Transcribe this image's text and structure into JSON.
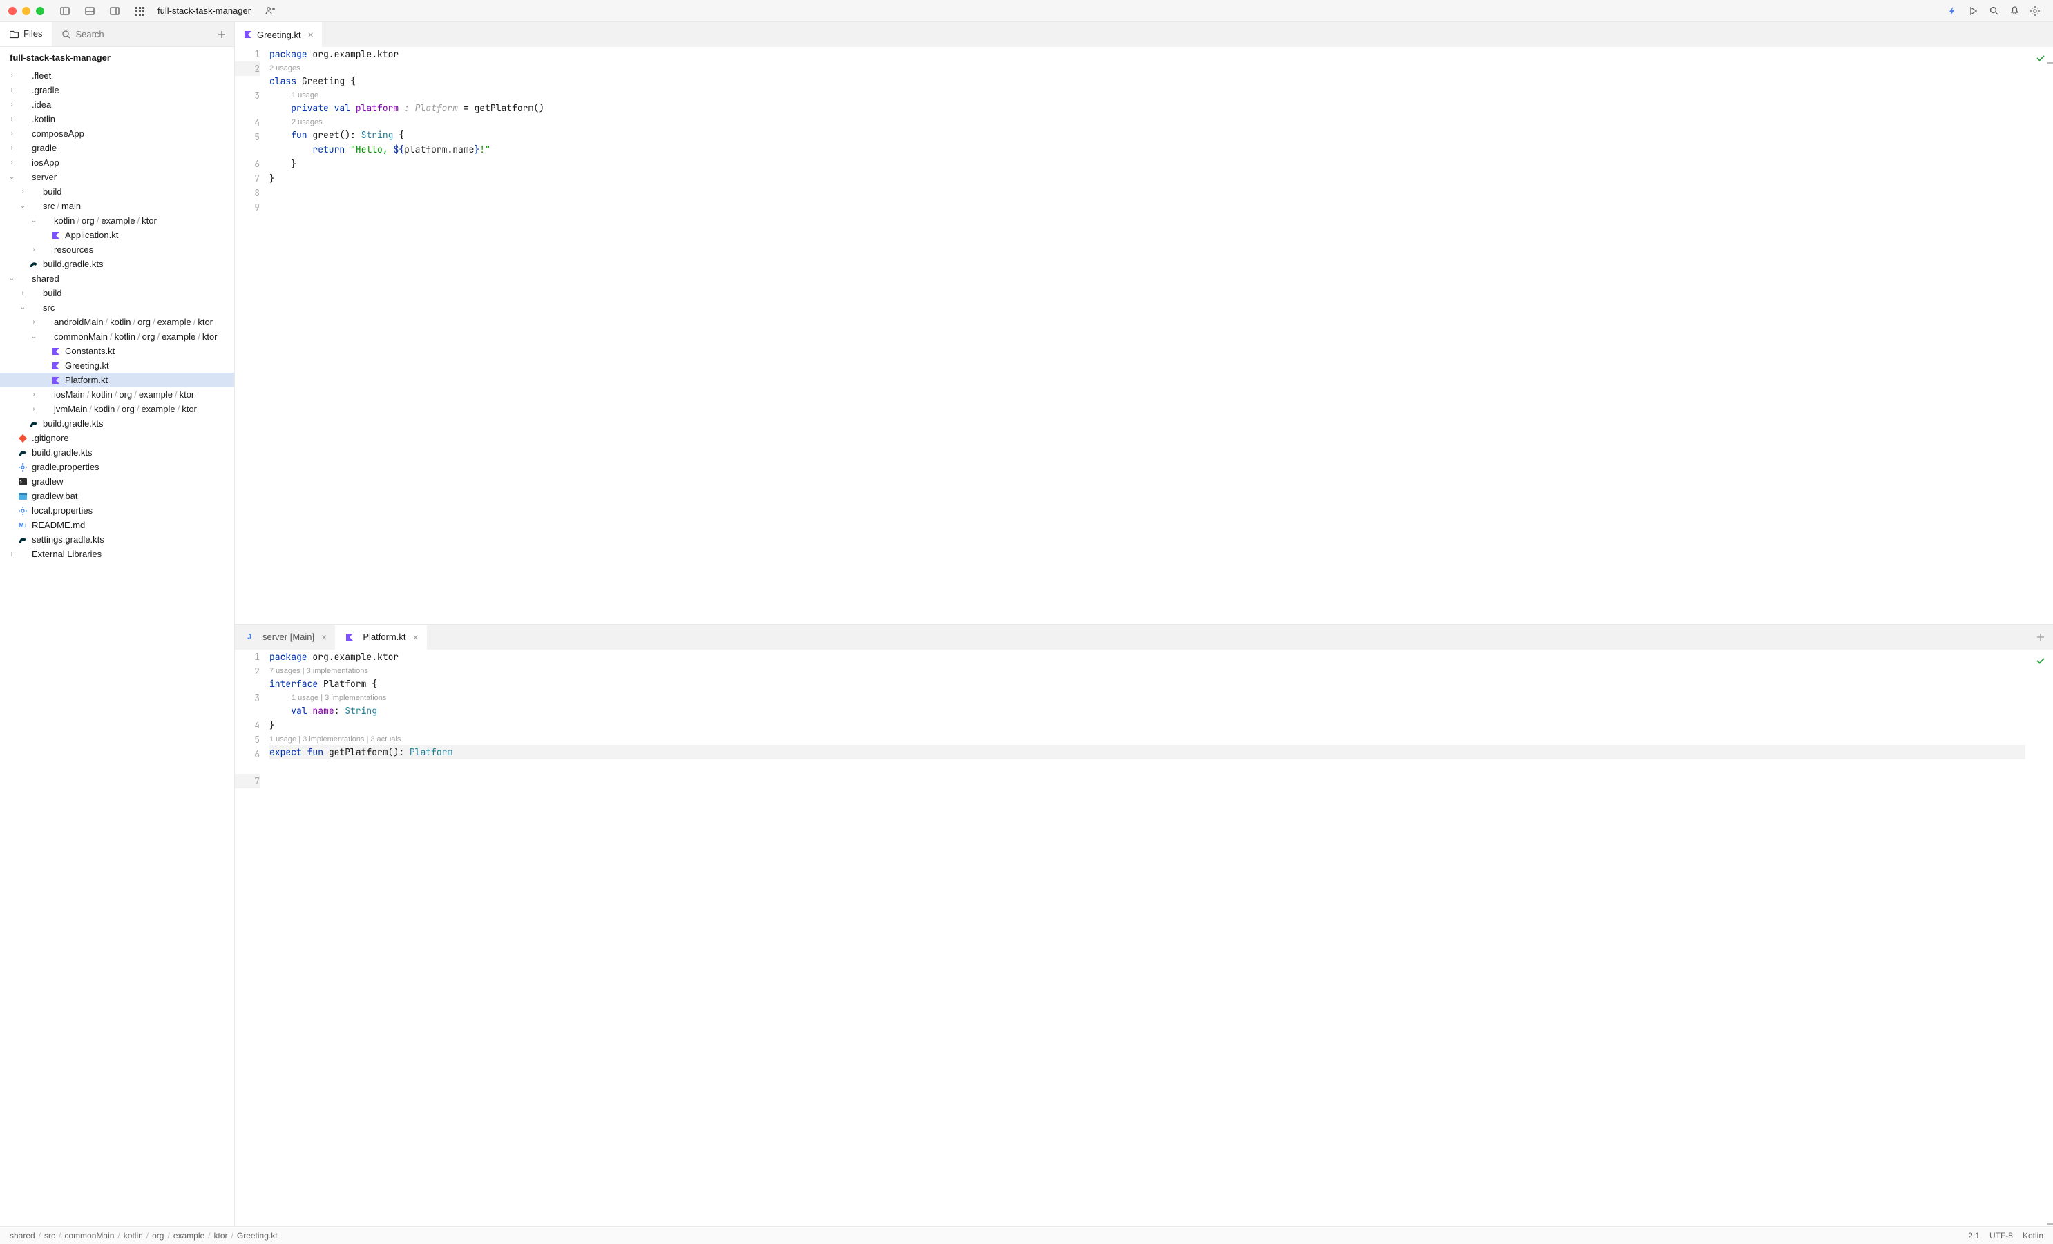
{
  "window": {
    "title": "full-stack-task-manager"
  },
  "sidebar": {
    "tabs": {
      "files": "Files",
      "search": "Search"
    },
    "project": "full-stack-task-manager",
    "tree": [
      {
        "depth": 0,
        "chev": "right",
        "label": ".fleet"
      },
      {
        "depth": 0,
        "chev": "right",
        "label": ".gradle"
      },
      {
        "depth": 0,
        "chev": "right",
        "label": ".idea"
      },
      {
        "depth": 0,
        "chev": "right",
        "label": ".kotlin"
      },
      {
        "depth": 0,
        "chev": "right",
        "label": "composeApp"
      },
      {
        "depth": 0,
        "chev": "right",
        "label": "gradle"
      },
      {
        "depth": 0,
        "chev": "right",
        "label": "iosApp"
      },
      {
        "depth": 0,
        "chev": "down",
        "label": "server"
      },
      {
        "depth": 1,
        "chev": "right",
        "label": "build"
      },
      {
        "depth": 1,
        "chev": "down",
        "path": [
          "src",
          "main"
        ]
      },
      {
        "depth": 2,
        "chev": "down",
        "path": [
          "kotlin",
          "org",
          "example",
          "ktor"
        ]
      },
      {
        "depth": 3,
        "chev": "",
        "icon": "kt",
        "label": "Application.kt"
      },
      {
        "depth": 2,
        "chev": "right",
        "label": "resources"
      },
      {
        "depth": 1,
        "chev": "",
        "icon": "gradle",
        "label": "build.gradle.kts"
      },
      {
        "depth": 0,
        "chev": "down",
        "label": "shared"
      },
      {
        "depth": 1,
        "chev": "right",
        "label": "build"
      },
      {
        "depth": 1,
        "chev": "down",
        "label": "src"
      },
      {
        "depth": 2,
        "chev": "right",
        "path": [
          "androidMain",
          "kotlin",
          "org",
          "example",
          "ktor"
        ]
      },
      {
        "depth": 2,
        "chev": "down",
        "path": [
          "commonMain",
          "kotlin",
          "org",
          "example",
          "ktor"
        ]
      },
      {
        "depth": 3,
        "chev": "",
        "icon": "kt",
        "label": "Constants.kt"
      },
      {
        "depth": 3,
        "chev": "",
        "icon": "kt",
        "label": "Greeting.kt"
      },
      {
        "depth": 3,
        "chev": "",
        "icon": "kt",
        "label": "Platform.kt",
        "selected": true
      },
      {
        "depth": 2,
        "chev": "right",
        "path": [
          "iosMain",
          "kotlin",
          "org",
          "example",
          "ktor"
        ]
      },
      {
        "depth": 2,
        "chev": "right",
        "path": [
          "jvmMain",
          "kotlin",
          "org",
          "example",
          "ktor"
        ]
      },
      {
        "depth": 1,
        "chev": "",
        "icon": "gradle",
        "label": "build.gradle.kts"
      },
      {
        "depth": 0,
        "chev": "",
        "icon": "git",
        "label": ".gitignore"
      },
      {
        "depth": 0,
        "chev": "",
        "icon": "gradle",
        "label": "build.gradle.kts"
      },
      {
        "depth": 0,
        "chev": "",
        "icon": "gear",
        "label": "gradle.properties"
      },
      {
        "depth": 0,
        "chev": "",
        "icon": "term",
        "label": "gradlew"
      },
      {
        "depth": 0,
        "chev": "",
        "icon": "bat",
        "label": "gradlew.bat"
      },
      {
        "depth": 0,
        "chev": "",
        "icon": "gear",
        "label": "local.properties"
      },
      {
        "depth": 0,
        "chev": "",
        "icon": "md",
        "label": "README.md"
      },
      {
        "depth": 0,
        "chev": "",
        "icon": "gradle",
        "label": "settings.gradle.kts"
      },
      {
        "depth": 0,
        "chev": "right",
        "label": "External Libraries"
      }
    ]
  },
  "top_editor": {
    "tab": "Greeting.kt",
    "lines": [
      {
        "n": "1",
        "tokens": [
          [
            "kw",
            "package"
          ],
          [
            "",
            ""
          ],
          [
            "ident",
            " org.example.ktor"
          ]
        ]
      },
      {
        "n": "2",
        "tokens": [
          [
            "",
            ""
          ]
        ],
        "hl": true
      },
      {
        "n": "",
        "hint": "2 usages",
        "indent": 0
      },
      {
        "n": "3",
        "tokens": [
          [
            "kw",
            "class"
          ],
          [
            "",
            " "
          ],
          [
            "classname",
            "Greeting"
          ],
          [
            "",
            " {"
          ]
        ]
      },
      {
        "n": "",
        "hint": "1 usage",
        "indent": 4
      },
      {
        "n": "4",
        "tokens": [
          [
            "",
            "    "
          ],
          [
            "kw",
            "private val"
          ],
          [
            "",
            " "
          ],
          [
            "prop",
            "platform"
          ],
          [
            "italic-type",
            " : Platform"
          ],
          [
            "",
            " = "
          ],
          [
            "func",
            "getPlatform"
          ],
          [
            "",
            "()"
          ]
        ]
      },
      {
        "n": "5",
        "tokens": [
          [
            "",
            ""
          ]
        ]
      },
      {
        "n": "",
        "hint": "2 usages",
        "indent": 4
      },
      {
        "n": "6",
        "tokens": [
          [
            "",
            "    "
          ],
          [
            "kw",
            "fun"
          ],
          [
            "",
            " "
          ],
          [
            "func",
            "greet"
          ],
          [
            "",
            "(): "
          ],
          [
            "type",
            "String"
          ],
          [
            "",
            " {"
          ]
        ]
      },
      {
        "n": "7",
        "tokens": [
          [
            "",
            "        "
          ],
          [
            "kw",
            "return"
          ],
          [
            "",
            " "
          ],
          [
            "str",
            "\"Hello, "
          ],
          [
            "tpl",
            "${"
          ],
          [
            "ident",
            "platform.name"
          ],
          [
            "tpl",
            "}"
          ],
          [
            "str",
            "!\""
          ]
        ]
      },
      {
        "n": "8",
        "tokens": [
          [
            "",
            "    }"
          ]
        ]
      },
      {
        "n": "9",
        "tokens": [
          [
            "",
            "}"
          ]
        ]
      }
    ]
  },
  "bottom_editor": {
    "tabs": [
      {
        "label": "server [Main]",
        "icon": "j",
        "active": false
      },
      {
        "label": "Platform.kt",
        "icon": "kt",
        "active": true
      }
    ],
    "lines": [
      {
        "n": "1",
        "tokens": [
          [
            "kw",
            "package"
          ],
          [
            "",
            " "
          ],
          [
            "ident",
            "org.example.ktor"
          ]
        ]
      },
      {
        "n": "2",
        "tokens": [
          [
            "",
            ""
          ]
        ]
      },
      {
        "n": "",
        "hint": "7 usages | 3 implementations",
        "indent": 0
      },
      {
        "n": "3",
        "tokens": [
          [
            "kw",
            "interface"
          ],
          [
            "",
            " "
          ],
          [
            "classname",
            "Platform"
          ],
          [
            "",
            " {"
          ]
        ]
      },
      {
        "n": "",
        "hint": "1 usage | 3 implementations",
        "indent": 4
      },
      {
        "n": "4",
        "tokens": [
          [
            "",
            "    "
          ],
          [
            "kw",
            "val"
          ],
          [
            "",
            " "
          ],
          [
            "prop",
            "name"
          ],
          [
            "",
            ": "
          ],
          [
            "type",
            "String"
          ]
        ]
      },
      {
        "n": "5",
        "tokens": [
          [
            "",
            "}"
          ]
        ]
      },
      {
        "n": "6",
        "tokens": [
          [
            "",
            ""
          ]
        ]
      },
      {
        "n": "",
        "hint": "1 usage | 3 implementations | 3 actuals",
        "indent": 0
      },
      {
        "n": "7",
        "tokens": [
          [
            "kw",
            "expect fun"
          ],
          [
            "",
            " "
          ],
          [
            "func",
            "getPlatform"
          ],
          [
            "",
            "(): "
          ],
          [
            "type",
            "Platform"
          ]
        ],
        "hl": true
      }
    ]
  },
  "statusbar": {
    "crumbs": [
      "shared",
      "src",
      "commonMain",
      "kotlin",
      "org",
      "example",
      "ktor",
      "Greeting.kt"
    ],
    "pos": "2:1",
    "encoding": "UTF-8",
    "lang": "Kotlin"
  }
}
